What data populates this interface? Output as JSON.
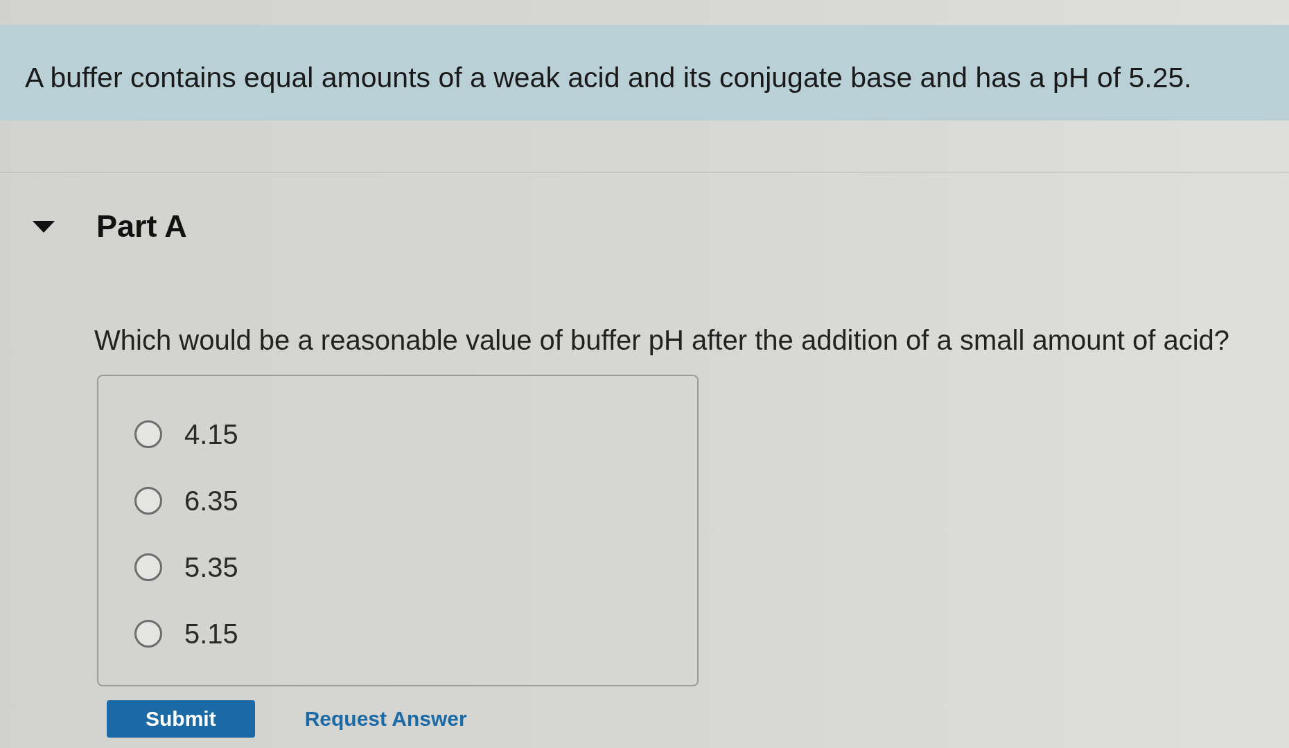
{
  "problem": {
    "text": "A buffer contains equal amounts of a weak acid and its conjugate base and has a pH of 5.25."
  },
  "part": {
    "title": "Part A",
    "expanded": true
  },
  "question": {
    "text": "Which would be a reasonable value of buffer pH after the addition of a small amount of acid?"
  },
  "choices": [
    {
      "label": "4.15",
      "selected": false
    },
    {
      "label": "6.35",
      "selected": false
    },
    {
      "label": "5.35",
      "selected": false
    },
    {
      "label": "5.15",
      "selected": false
    }
  ],
  "actions": [
    {
      "kind": "primary",
      "label": "Submit"
    },
    {
      "kind": "link",
      "label": "Request Answer"
    }
  ]
}
